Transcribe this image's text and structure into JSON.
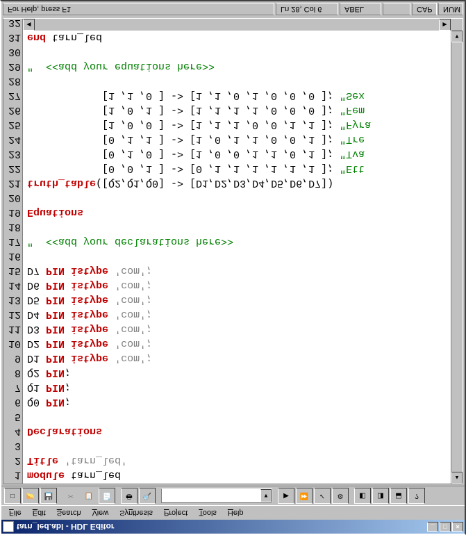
{
  "window": {
    "title": "tarn_led.abl - HDL Editor",
    "btn_min": "_",
    "btn_max": "□",
    "btn_close": "×"
  },
  "menu": {
    "file": "File",
    "file_u": "F",
    "edit": "Edit",
    "edit_u": "E",
    "search": "Search",
    "search_u": "S",
    "view": "View",
    "view_u": "V",
    "synthesis": "Synthesis",
    "synthesis_u": "n",
    "project": "Project",
    "project_u": "P",
    "tools": "Tools",
    "tools_u": "T",
    "help": "Help",
    "help_u": "H"
  },
  "toolbar": {
    "new": "□",
    "open": "📂",
    "save": "💾",
    "cut": "✂",
    "copy": "📋",
    "paste": "📄",
    "print": "🖶",
    "find": "🔍",
    "run1": "▶",
    "run2": "⏩",
    "check": "✓",
    "opts": "⚙",
    "t1": "◧",
    "t2": "◨",
    "t3": "⬓",
    "help": "?"
  },
  "code": {
    "lines": [
      {
        "n": "1",
        "seg": [
          {
            "t": "module",
            "c": "kw"
          },
          {
            "t": " tarn_led"
          }
        ]
      },
      {
        "n": "2",
        "seg": [
          {
            "t": "Title",
            "c": "kw"
          },
          {
            "t": " 'tarn_led'",
            "c": "str"
          }
        ]
      },
      {
        "n": "3",
        "seg": []
      },
      {
        "n": "4",
        "seg": [
          {
            "t": "Declarations",
            "c": "kw"
          }
        ]
      },
      {
        "n": "5",
        "seg": []
      },
      {
        "n": "6",
        "seg": [
          {
            "t": "Q0 "
          },
          {
            "t": "PIN",
            "c": "kw"
          },
          {
            "t": ";"
          }
        ]
      },
      {
        "n": "7",
        "seg": [
          {
            "t": "Q1 "
          },
          {
            "t": "PIN",
            "c": "kw"
          },
          {
            "t": ";"
          }
        ]
      },
      {
        "n": "8",
        "seg": [
          {
            "t": "Q2 "
          },
          {
            "t": "PIN",
            "c": "kw"
          },
          {
            "t": ";"
          }
        ]
      },
      {
        "n": "9",
        "seg": [
          {
            "t": "D1 "
          },
          {
            "t": "PIN",
            "c": "kw"
          },
          {
            "t": " "
          },
          {
            "t": "istype",
            "c": "kw"
          },
          {
            "t": " 'com';",
            "c": "str"
          }
        ]
      },
      {
        "n": "10",
        "seg": [
          {
            "t": "D2 "
          },
          {
            "t": "PIN",
            "c": "kw"
          },
          {
            "t": " "
          },
          {
            "t": "istype",
            "c": "kw"
          },
          {
            "t": " 'com';",
            "c": "str"
          }
        ]
      },
      {
        "n": "11",
        "seg": [
          {
            "t": "D3 "
          },
          {
            "t": "PIN",
            "c": "kw"
          },
          {
            "t": " "
          },
          {
            "t": "istype",
            "c": "kw"
          },
          {
            "t": " 'com';",
            "c": "str"
          }
        ]
      },
      {
        "n": "12",
        "seg": [
          {
            "t": "D4 "
          },
          {
            "t": "PIN",
            "c": "kw"
          },
          {
            "t": " "
          },
          {
            "t": "istype",
            "c": "kw"
          },
          {
            "t": " 'com';",
            "c": "str"
          }
        ]
      },
      {
        "n": "13",
        "seg": [
          {
            "t": "D5 "
          },
          {
            "t": "PIN",
            "c": "kw"
          },
          {
            "t": " "
          },
          {
            "t": "istype",
            "c": "kw"
          },
          {
            "t": " 'com';",
            "c": "str"
          }
        ]
      },
      {
        "n": "14",
        "seg": [
          {
            "t": "D6 "
          },
          {
            "t": "PIN",
            "c": "kw"
          },
          {
            "t": " "
          },
          {
            "t": "istype",
            "c": "kw"
          },
          {
            "t": " 'com';",
            "c": "str"
          }
        ]
      },
      {
        "n": "15",
        "seg": [
          {
            "t": "D7 "
          },
          {
            "t": "PIN",
            "c": "kw"
          },
          {
            "t": " "
          },
          {
            "t": "istype",
            "c": "kw"
          },
          {
            "t": " 'com';",
            "c": "str"
          }
        ]
      },
      {
        "n": "16",
        "seg": []
      },
      {
        "n": "17",
        "seg": [
          {
            "t": "\"  <<add your declarations here>>",
            "c": "cm"
          }
        ]
      },
      {
        "n": "18",
        "seg": []
      },
      {
        "n": "19",
        "seg": [
          {
            "t": "Equations",
            "c": "kw"
          }
        ]
      },
      {
        "n": "20",
        "seg": []
      },
      {
        "n": "21",
        "seg": [
          {
            "t": "truth_table",
            "c": "kw"
          },
          {
            "t": "([Q2,Q1,Q0] -> [D1,D2,D3,D4,D5,D6,D7])"
          }
        ]
      },
      {
        "n": "22",
        "seg": [
          {
            "t": "            [0 ,0 ,1 ] -> [0 ,1 ,1 ,1 ,1 ,1 ,1 ]; "
          },
          {
            "t": "\"Ett",
            "c": "cm"
          }
        ]
      },
      {
        "n": "23",
        "seg": [
          {
            "t": "            [0 ,1 ,0 ] -> [1 ,0 ,0 ,1 ,1 ,0 ,1 ]; "
          },
          {
            "t": "\"Tva",
            "c": "cm"
          }
        ]
      },
      {
        "n": "24",
        "seg": [
          {
            "t": "            [0 ,1 ,1 ] -> [1 ,0 ,1 ,1 ,0 ,0 ,1 ]; "
          },
          {
            "t": "\"Tre",
            "c": "cm"
          }
        ]
      },
      {
        "n": "25",
        "seg": [
          {
            "t": "            [1 ,0 ,0 ] -> [1 ,1 ,1 ,0 ,0 ,1 ,1 ]; "
          },
          {
            "t": "\"Fyra",
            "c": "cm"
          }
        ]
      },
      {
        "n": "26",
        "seg": [
          {
            "t": "            [1 ,0 ,1 ] -> [1 ,1 ,1 ,1 ,0 ,0 ,0 ]; "
          },
          {
            "t": "\"Fem",
            "c": "cm"
          }
        ]
      },
      {
        "n": "27",
        "seg": [
          {
            "t": "            [1 ,1 ,0 ] -> [1 ,1 ,0 ,1 ,0 ,0 ,0 ]; "
          },
          {
            "t": "\"Sex",
            "c": "cm"
          }
        ]
      },
      {
        "n": "28",
        "seg": []
      },
      {
        "n": "29",
        "seg": [
          {
            "t": "\"  <<add your equations here>>",
            "c": "cm"
          }
        ]
      },
      {
        "n": "30",
        "seg": []
      },
      {
        "n": "31",
        "seg": [
          {
            "t": "end",
            "c": "kw"
          },
          {
            "t": " tarn_led"
          }
        ]
      },
      {
        "n": "32",
        "seg": []
      }
    ]
  },
  "status": {
    "help": "For Help, press F1",
    "pos": "Ln 28, Col 6",
    "lang": "ABEL",
    "blank": "",
    "cap": "CAP",
    "num": "NUM"
  }
}
